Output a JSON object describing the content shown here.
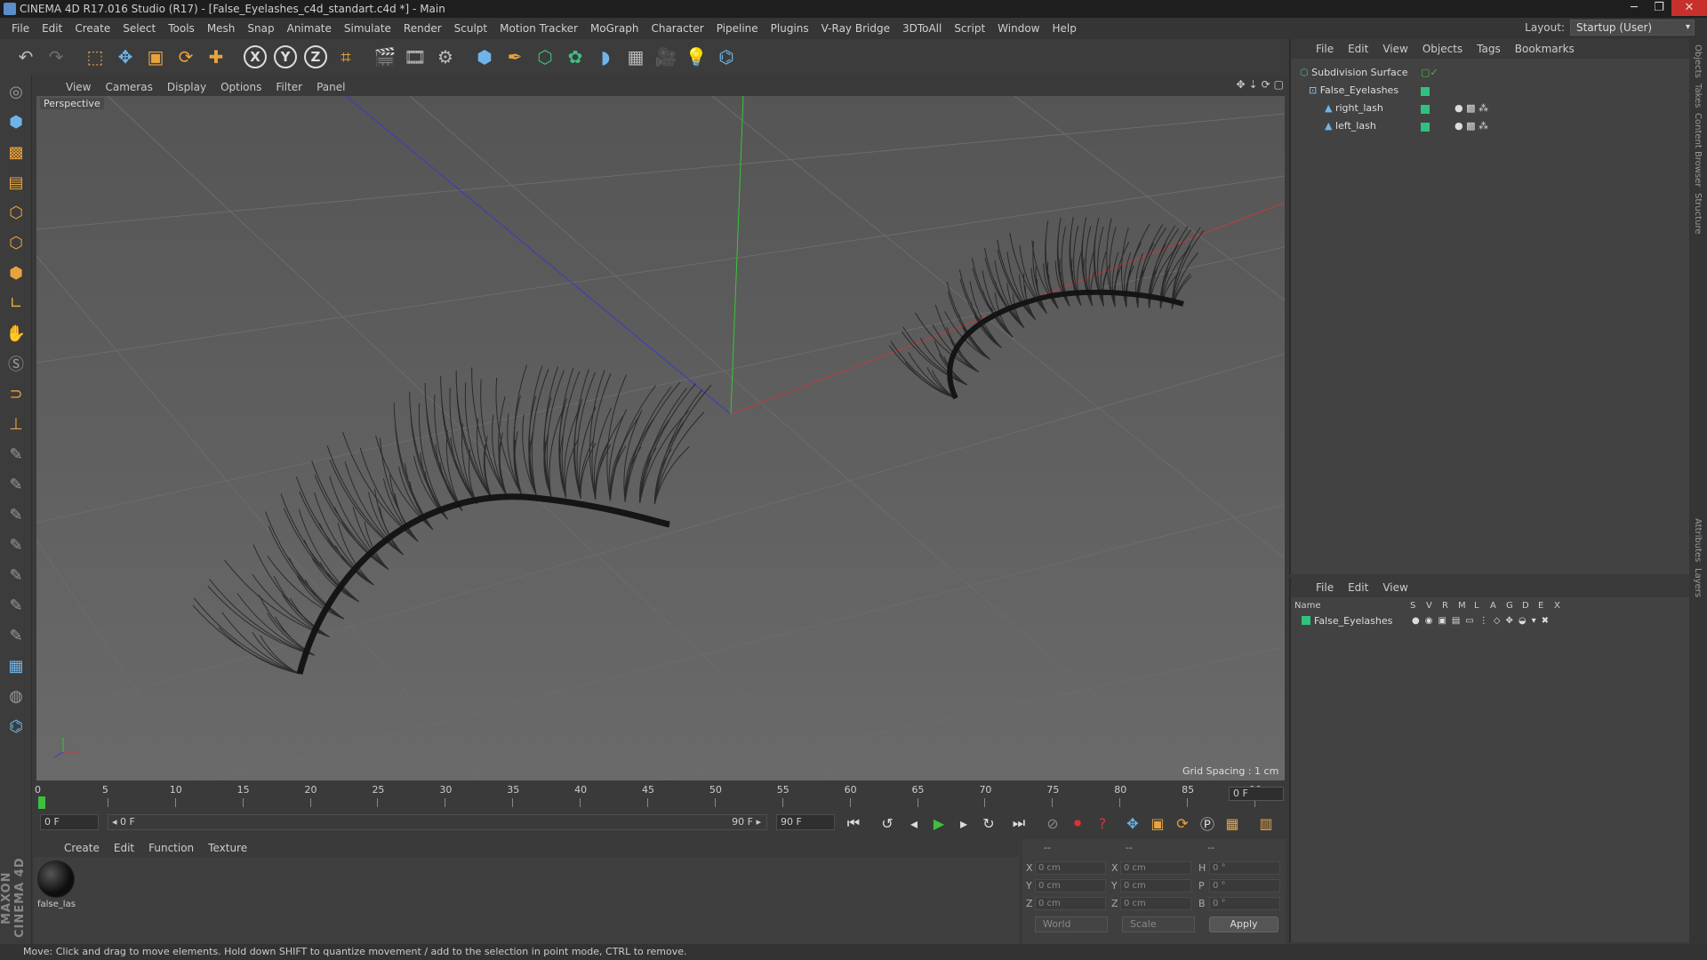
{
  "window": {
    "title": "CINEMA 4D R17.016 Studio (R17) - [False_Eyelashes_c4d_standart.c4d *] - Main",
    "controls": [
      "─",
      "❐",
      "✕"
    ]
  },
  "menubar": {
    "items": [
      "File",
      "Edit",
      "Create",
      "Select",
      "Tools",
      "Mesh",
      "Snap",
      "Animate",
      "Simulate",
      "Render",
      "Sculpt",
      "Motion Tracker",
      "MoGraph",
      "Character",
      "Pipeline",
      "Plugins",
      "V-Ray Bridge",
      "3DToAll",
      "Script",
      "Window",
      "Help"
    ],
    "layout_label": "Layout:",
    "layout_value": "Startup (User)"
  },
  "toolbar": {
    "icons": [
      "undo-icon",
      "redo-icon",
      "live-selection-icon",
      "move-icon",
      "scale-icon",
      "rotate-icon",
      "recent-tool-icon",
      "x-axis-icon",
      "y-axis-icon",
      "z-axis-icon",
      "world-coord-icon",
      "render-view-icon",
      "render-picture-viewer-icon",
      "edit-render-settings-icon",
      "cube-icon",
      "pen-spline-icon",
      "subdivision-icon",
      "cloner-icon",
      "deformer-icon",
      "floor-icon",
      "camera-icon",
      "light-icon",
      "python-icon"
    ],
    "axis_labels": [
      "X",
      "Y",
      "Z"
    ]
  },
  "viewport": {
    "menu": [
      "View",
      "Cameras",
      "Display",
      "Options",
      "Filter",
      "Panel"
    ],
    "label": "Perspective",
    "grid_spacing": "Grid Spacing : 1 cm"
  },
  "timeline": {
    "ticks": [
      "0",
      "5",
      "10",
      "15",
      "20",
      "25",
      "30",
      "35",
      "40",
      "45",
      "50",
      "55",
      "60",
      "65",
      "70",
      "75",
      "80",
      "85",
      "90"
    ],
    "current_frame": "0 F",
    "start_field": "0 F",
    "range_start": "◂ 0 F",
    "range_end": "90 F ▸",
    "end_field": "90 F"
  },
  "material_manager": {
    "menu": [
      "Create",
      "Edit",
      "Function",
      "Texture"
    ],
    "materials": [
      {
        "name": "false_las"
      }
    ]
  },
  "coordinates": {
    "headers": [
      "--",
      "--",
      "--"
    ],
    "rows": [
      {
        "axis": "X",
        "pos": "0 cm",
        "axis2": "X",
        "size": "0 cm",
        "rot_axis": "H",
        "rot": "0 °"
      },
      {
        "axis": "Y",
        "pos": "0 cm",
        "axis2": "Y",
        "size": "0 cm",
        "rot_axis": "P",
        "rot": "0 °"
      },
      {
        "axis": "Z",
        "pos": "0 cm",
        "axis2": "Z",
        "size": "0 cm",
        "rot_axis": "B",
        "rot": "0 °"
      }
    ],
    "space": "World",
    "mode": "Scale",
    "apply": "Apply"
  },
  "status": "Move: Click and drag to move elements. Hold down SHIFT to quantize movement / add to the selection in point mode, CTRL to remove.",
  "object_manager": {
    "menu": [
      "File",
      "Edit",
      "View",
      "Objects",
      "Tags",
      "Bookmarks"
    ],
    "objects": [
      {
        "name": "Subdivision Surface",
        "icon": "subdivision-icon"
      },
      {
        "name": "False_Eyelashes",
        "icon": "null-icon"
      },
      {
        "name": "right_lash",
        "icon": "polygon-icon"
      },
      {
        "name": "left_lash",
        "icon": "polygon-icon"
      }
    ]
  },
  "layer_manager": {
    "menu": [
      "File",
      "Edit",
      "View"
    ],
    "headers": [
      "Name",
      "S",
      "V",
      "R",
      "M",
      "L",
      "A",
      "G",
      "D",
      "E",
      "X"
    ],
    "layers": [
      {
        "name": "False_Eyelashes",
        "color": "#2ec27e"
      }
    ]
  },
  "side_tabs": [
    "Objects",
    "Takes",
    "Content Browser",
    "Structure",
    "Attributes",
    "Layers"
  ],
  "maxon_logo": "MAXON CINEMA 4D",
  "colors": {
    "accent": "#e8a33d",
    "layer": "#2ec27e",
    "axis_x": "#c43a3a",
    "axis_y": "#3ac43a",
    "axis_z": "#3a3ac4"
  }
}
